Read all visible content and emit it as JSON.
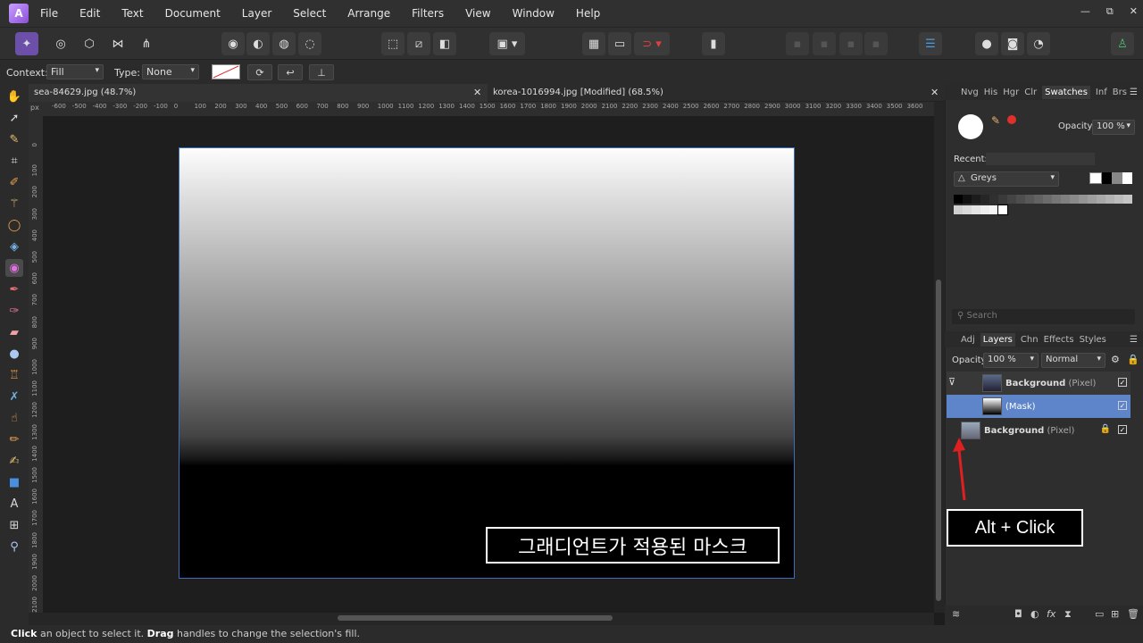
{
  "menubar": {
    "logo": "A",
    "items": [
      "File",
      "Edit",
      "Text",
      "Document",
      "Layer",
      "Select",
      "Arrange",
      "Filters",
      "View",
      "Window",
      "Help"
    ],
    "window_controls": [
      "—",
      "⧉",
      "✕"
    ]
  },
  "context": {
    "context_label": "Context:",
    "context_value": "Fill",
    "type_label": "Type:",
    "type_value": "None"
  },
  "tabs": [
    {
      "title": "sea-84629.jpg (48.7%)"
    },
    {
      "title": "korea-1016994.jpg [Modified] (68.5%)"
    }
  ],
  "ruler": {
    "unit": "px",
    "h_ticks": [
      "-600",
      "-500",
      "-400",
      "-300",
      "-200",
      "-100",
      "0",
      "100",
      "200",
      "300",
      "400",
      "500",
      "600",
      "700",
      "800",
      "900",
      "1000",
      "1100",
      "1200",
      "1300",
      "1400",
      "1500",
      "1600",
      "1700",
      "1800",
      "1900",
      "2000",
      "2100",
      "2200",
      "2300",
      "2400",
      "2500",
      "2600",
      "2700",
      "2800",
      "2900",
      "3000",
      "3100",
      "3200",
      "3300",
      "3400",
      "3500",
      "3600"
    ],
    "v_ticks": [
      "0",
      "100",
      "200",
      "300",
      "400",
      "500",
      "600",
      "700",
      "800",
      "900",
      "1000",
      "1100",
      "1200",
      "1300",
      "1400",
      "1500",
      "1600",
      "1700",
      "1800",
      "1900",
      "2000",
      "2100"
    ]
  },
  "canvas": {
    "annotation": "그래디언트가 적용된 마스크"
  },
  "swatches_panel": {
    "tabs": [
      "Nvg",
      "His",
      "Hgr",
      "Clr",
      "Swatches",
      "Inf",
      "Brs"
    ],
    "active_tab": "Swatches",
    "opacity_label": "Opacity:",
    "opacity_value": "100 %",
    "recent_label": "Recent:",
    "palette": "Greys",
    "grey_colors": [
      "#000000",
      "#111111",
      "#1c1c1c",
      "#262626",
      "#303030",
      "#3a3a3a",
      "#444444",
      "#4e4e4e",
      "#585858",
      "#626262",
      "#6c6c6c",
      "#767676",
      "#808080",
      "#8a8a8a",
      "#949494",
      "#9e9e9e",
      "#a8a8a8",
      "#b2b2b2",
      "#bcbcbc",
      "#c6c6c6",
      "#d0d0d0",
      "#dadada",
      "#e4e4e4",
      "#eeeeee",
      "#f7f7f7",
      "#ffffff"
    ]
  },
  "search": {
    "placeholder": "Search"
  },
  "layers_panel": {
    "tabs": [
      "Adj",
      "Layers",
      "Chn",
      "Effects",
      "Styles"
    ],
    "active_tab": "Layers",
    "opacity_label": "Opacity:",
    "opacity_value": "100 %",
    "blend_mode": "Normal",
    "layers": [
      {
        "name": "Background",
        "kind": "(Pixel)"
      },
      {
        "name": "",
        "kind": "(Mask)"
      },
      {
        "name": "Background",
        "kind": "(Pixel)"
      }
    ]
  },
  "callout": {
    "text": "Alt + Click"
  },
  "status": {
    "click": "Click",
    "text1": " an object to select it. ",
    "drag": "Drag",
    "text2": " handles to change the selection's fill."
  }
}
